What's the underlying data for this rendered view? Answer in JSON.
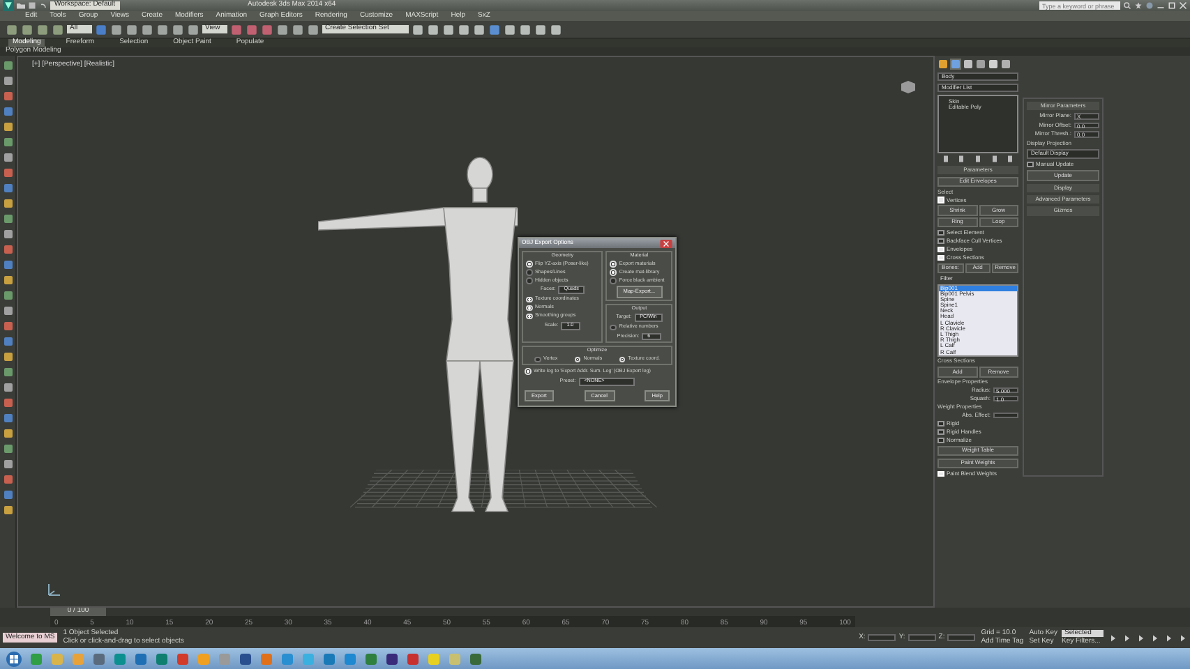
{
  "title_bar": {
    "workspace": "Workspace: Default",
    "file": "Autodesk 3ds Max 2014 x64",
    "search_placeholder": "Type a keyword or phrase"
  },
  "menu": [
    "Edit",
    "Tools",
    "Group",
    "Views",
    "Create",
    "Modifiers",
    "Animation",
    "Graph Editors",
    "Rendering",
    "Customize",
    "MAXScript",
    "Help",
    "SxZ"
  ],
  "toolbar": {
    "filter": "All",
    "coord": "View",
    "selection_set": "Create Selection Set"
  },
  "ribbon": {
    "tabs": [
      {
        "label": "Modeling",
        "selected": true
      },
      {
        "label": "Freeform",
        "selected": false
      },
      {
        "label": "Selection",
        "selected": false
      },
      {
        "label": "Object Paint",
        "selected": false
      },
      {
        "label": "Populate",
        "selected": false
      }
    ],
    "subtitle": "Polygon Modeling"
  },
  "viewport": {
    "label": "[+] [Perspective] [Realistic]"
  },
  "dialog": {
    "title": "OBJ Export Options",
    "geometry": {
      "title": "Geometry",
      "options": [
        {
          "label": "Flip YZ-axis (Poser-like)",
          "checked": true
        },
        {
          "label": "Shapes/Lines",
          "checked": false
        },
        {
          "label": "Hidden objects",
          "checked": false
        }
      ],
      "faces_label": "Faces:",
      "faces_value": "Quads",
      "options2": [
        {
          "label": "Texture coordinates",
          "checked": true
        },
        {
          "label": "Normals",
          "checked": true
        },
        {
          "label": "Smoothing groups",
          "checked": true
        }
      ],
      "scale_label": "Scale:",
      "scale_value": "1.0"
    },
    "material": {
      "title": "Material",
      "options": [
        {
          "label": "Export materials",
          "checked": true
        },
        {
          "label": "Create mat-library",
          "checked": true
        },
        {
          "label": "Force black ambient",
          "checked": false
        }
      ],
      "button": "Map-Export..."
    },
    "output": {
      "title": "Output",
      "target_label": "Target:",
      "target_value": "PC/Win",
      "options": [
        {
          "label": "Relative numbers",
          "checked": false
        }
      ],
      "precision_label": "Precision:",
      "precision_value": "6"
    },
    "optimize": {
      "title": "Optimize",
      "options": [
        {
          "label": "Vertex",
          "selected": false
        },
        {
          "label": "Normals",
          "selected": true
        },
        {
          "label": "Texture coord.",
          "selected": true
        }
      ]
    },
    "log": {
      "label": "Write log to 'Export Addr. Sum. Log' (OBJ Export log)",
      "checked": true
    },
    "preset_label": "Preset:",
    "preset_value": "<NONE>",
    "buttons": [
      "Export",
      "Cancel",
      "Help"
    ]
  },
  "command_panel": {
    "object_name": "Body",
    "modifier_list": "Modifier List",
    "stack": [
      "Skin",
      "Editable Poly"
    ],
    "parameters": "Parameters",
    "edit_envelopes": "Edit Envelopes",
    "select_title": "Select",
    "select_options": [
      {
        "label": "Vertices",
        "checked": true
      }
    ],
    "select_buttons": [
      "Shrink",
      "Grow",
      "Ring",
      "Loop"
    ],
    "select_options2": [
      {
        "label": "Select Element",
        "checked": false
      },
      {
        "label": "Backface Cull Vertices",
        "checked": false
      },
      {
        "label": "Envelopes",
        "checked": true
      },
      {
        "label": "Cross Sections",
        "checked": true
      }
    ],
    "bone_buttons": [
      "Bones:",
      "Add",
      "Remove"
    ],
    "filter_label": "Filter",
    "bones": [
      {
        "label": "Bip001",
        "selected": true
      },
      {
        "label": "Bip001 Pelvis",
        "selected": false
      },
      {
        "label": "Spine",
        "selected": false
      },
      {
        "label": "Spine1",
        "selected": false
      },
      {
        "label": "Neck",
        "selected": false
      },
      {
        "label": "Head",
        "selected": false
      },
      {
        "label": "L Clavicle",
        "selected": false
      },
      {
        "label": "R Clavicle",
        "selected": false
      },
      {
        "label": "L Thigh",
        "selected": false
      },
      {
        "label": "R Thigh",
        "selected": false
      },
      {
        "label": "L Calf",
        "selected": false
      },
      {
        "label": "R Calf",
        "selected": false
      }
    ],
    "cross_sections": {
      "title": "Cross Sections",
      "buttons": [
        "Add",
        "Remove"
      ]
    },
    "envelope": {
      "title": "Envelope Properties",
      "radius_label": "Radius:",
      "radius": "5.000",
      "squash_label": "Squash:",
      "squash": "1.0"
    },
    "weight": {
      "title": "Weight Properties",
      "abs_label": "Abs. Effect:",
      "options": [
        {
          "label": "Rigid",
          "checked": false
        },
        {
          "label": "Rigid Handles",
          "checked": false
        },
        {
          "label": "Normalize",
          "checked": false
        }
      ],
      "table": "Weight Table",
      "paint": "Paint Weights",
      "blend": {
        "label": "Paint Blend Weights",
        "checked": true
      }
    },
    "mirror": {
      "title": "Mirror Parameters",
      "fields": [
        {
          "label": "Mirror Plane:",
          "value": "X"
        },
        {
          "label": "Mirror Offset:",
          "value": "0.0"
        },
        {
          "label": "Mirror Thresh.:",
          "value": "0.0"
        }
      ],
      "projection_label": "Display Projection",
      "projection_value": "Default Display",
      "manual": {
        "label": "Manual Update",
        "checked": false
      },
      "update": "Update",
      "rollouts": [
        "Display",
        "Advanced Parameters",
        "Gizmos"
      ]
    }
  },
  "timeline": {
    "slider": "0 / 100",
    "level": 0,
    "ticks": [
      "0",
      "5",
      "10",
      "15",
      "20",
      "25",
      "30",
      "35",
      "40",
      "45",
      "50",
      "55",
      "60",
      "65",
      "70",
      "75",
      "80",
      "85",
      "90",
      "95",
      "100"
    ]
  },
  "status": {
    "welcome": "Welcome to MS",
    "selected": "1 Object Selected",
    "prompt": "Click or click-and-drag to select objects",
    "axes": [
      "X:",
      "Y:",
      "Z:"
    ],
    "grid": "Grid = 10.0",
    "add_time_tag": "Add Time Tag",
    "auto_key": "Auto Key",
    "key_mode": "Selected",
    "set_key": "Set Key",
    "key_filters": "Key Filters..."
  },
  "taskbar": {
    "apps": [
      {
        "color": "#2f9e44"
      },
      {
        "color": "#d9b44a"
      },
      {
        "color": "#e8a23a"
      },
      {
        "color": "#5a6b7d"
      },
      {
        "color": "#0c8f8f"
      },
      {
        "color": "#1f6fb4"
      },
      {
        "color": "#0f7f70"
      },
      {
        "color": "#d23a2a"
      },
      {
        "color": "#f0a020"
      },
      {
        "color": "#9a9a9a"
      },
      {
        "color": "#2a4f8f"
      },
      {
        "color": "#e0701a"
      },
      {
        "color": "#2a8fd0"
      },
      {
        "color": "#3ab0e0"
      },
      {
        "color": "#1a7ab8"
      },
      {
        "color": "#1e88d0"
      },
      {
        "color": "#2f7f3f"
      },
      {
        "color": "#3a2a7a"
      },
      {
        "color": "#c83030"
      },
      {
        "color": "#e8d020"
      },
      {
        "color": "#c8c070"
      },
      {
        "color": "#3a6a3a"
      }
    ]
  }
}
